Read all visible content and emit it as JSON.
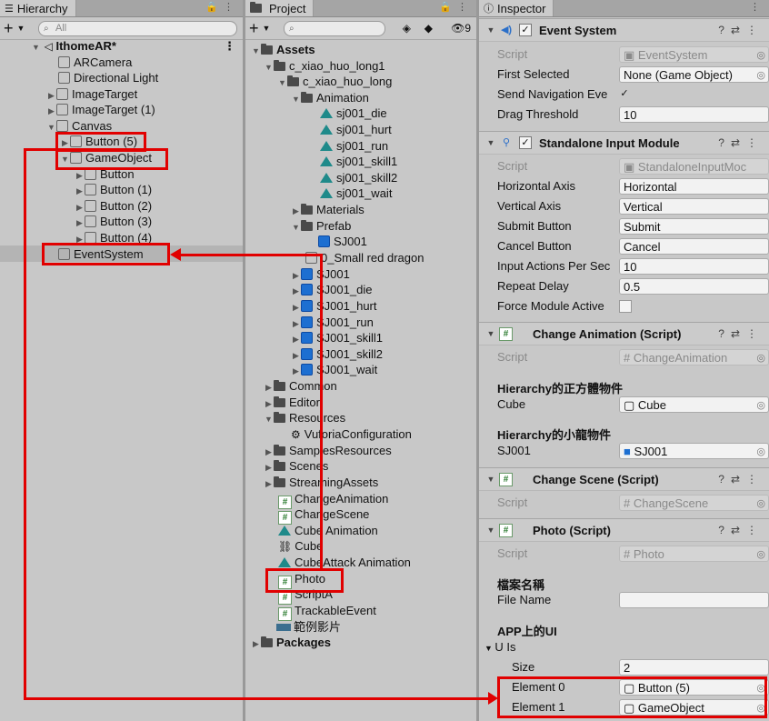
{
  "hierarchy": {
    "tab_label": "Hierarchy",
    "search_placeholder": "All",
    "scene_name": "IthomeAR*",
    "items": [
      {
        "label": "ARCamera"
      },
      {
        "label": "Directional Light"
      },
      {
        "label": "ImageTarget"
      },
      {
        "label": "ImageTarget (1)"
      },
      {
        "label": "Canvas"
      },
      {
        "label": "Button (5)"
      },
      {
        "label": "GameObject"
      },
      {
        "label": "Button"
      },
      {
        "label": "Button (1)"
      },
      {
        "label": "Button (2)"
      },
      {
        "label": "Button (3)"
      },
      {
        "label": "Button (4)"
      },
      {
        "label": "EventSystem"
      }
    ]
  },
  "project": {
    "tab_label": "Project",
    "hidden_count": "9",
    "items": [
      {
        "label": "Assets"
      },
      {
        "label": "c_xiao_huo_long1"
      },
      {
        "label": "c_xiao_huo_long"
      },
      {
        "label": "Animation"
      },
      {
        "label": "sj001_die"
      },
      {
        "label": "sj001_hurt"
      },
      {
        "label": "sj001_run"
      },
      {
        "label": "sj001_skill1"
      },
      {
        "label": "sj001_skill2"
      },
      {
        "label": "sj001_wait"
      },
      {
        "label": "Materials"
      },
      {
        "label": "Prefab"
      },
      {
        "label": "SJ001"
      },
      {
        "label": "0_Small red dragon"
      },
      {
        "label": "SJ001"
      },
      {
        "label": "SJ001_die"
      },
      {
        "label": "SJ001_hurt"
      },
      {
        "label": "SJ001_run"
      },
      {
        "label": "SJ001_skill1"
      },
      {
        "label": "SJ001_skill2"
      },
      {
        "label": "SJ001_wait"
      },
      {
        "label": "Common"
      },
      {
        "label": "Editor"
      },
      {
        "label": "Resources"
      },
      {
        "label": "VuforiaConfiguration"
      },
      {
        "label": "SamplesResources"
      },
      {
        "label": "Scenes"
      },
      {
        "label": "StreamingAssets"
      },
      {
        "label": "ChangeAnimation"
      },
      {
        "label": "ChangeScene"
      },
      {
        "label": "Cube Animation"
      },
      {
        "label": "Cube"
      },
      {
        "label": "CubeAttack Animation"
      },
      {
        "label": "Photo"
      },
      {
        "label": "ScriptA"
      },
      {
        "label": "TrackableEvent"
      },
      {
        "label": "範例影片"
      },
      {
        "label": "Packages"
      }
    ]
  },
  "inspector": {
    "tab_label": "Inspector",
    "event_system": {
      "title": "Event System",
      "script_label": "Script",
      "script_value": "EventSystem",
      "first_selected_label": "First Selected",
      "first_selected_value": "None (Game Object)",
      "send_nav_label": "Send Navigation Eve",
      "drag_label": "Drag Threshold",
      "drag_value": "10"
    },
    "standalone": {
      "title": "Standalone Input Module",
      "script_label": "Script",
      "script_value": "StandaloneInputMoc",
      "h_axis_label": "Horizontal Axis",
      "h_axis_value": "Horizontal",
      "v_axis_label": "Vertical Axis",
      "v_axis_value": "Vertical",
      "submit_label": "Submit Button",
      "submit_value": "Submit",
      "cancel_label": "Cancel Button",
      "cancel_value": "Cancel",
      "ips_label": "Input Actions Per Sec",
      "ips_value": "10",
      "repeat_label": "Repeat Delay",
      "repeat_value": "0.5",
      "force_label": "Force Module Active"
    },
    "change_anim": {
      "title": "Change Animation (Script)",
      "script_label": "Script",
      "script_value": "ChangeAnimation",
      "header1": "Hierarchy的正方體物件",
      "cube_label": "Cube",
      "cube_value": "Cube",
      "header2": "Hierarchy的小龍物件",
      "sj_label": "SJ001",
      "sj_value": "SJ001"
    },
    "change_scene": {
      "title": "Change Scene (Script)",
      "script_label": "Script",
      "script_value": "ChangeScene"
    },
    "photo": {
      "title": "Photo (Script)",
      "script_label": "Script",
      "script_value": "Photo",
      "header1": "檔案名稱",
      "file_label": "File Name",
      "file_value": "",
      "header2": "APP上的UI",
      "uis_label": "U Is",
      "size_label": "Size",
      "size_value": "2",
      "el0_label": "Element 0",
      "el0_value": "Button (5)",
      "el1_label": "Element 1",
      "el1_value": "GameObject"
    }
  },
  "colors": {
    "annotation_red": "#e10000",
    "script_green": "#2e7d32",
    "prefab_blue": "#1d6fd1"
  }
}
